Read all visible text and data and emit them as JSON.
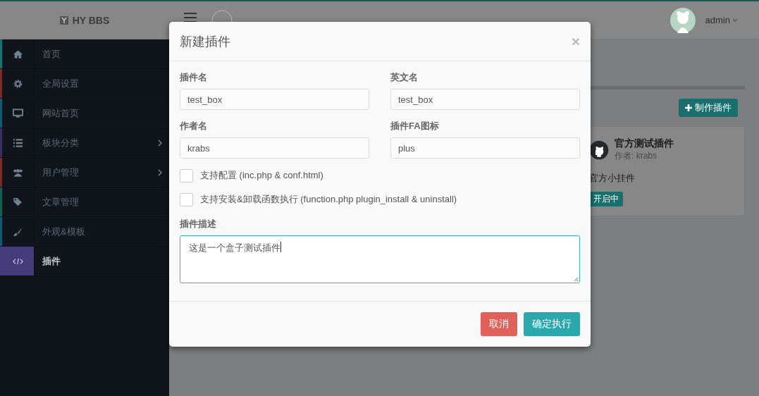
{
  "header": {
    "logo": "HY BBS",
    "user": "admin"
  },
  "sidebar": {
    "items": [
      {
        "label": "首页",
        "selected": false,
        "has_submenu": false,
        "color": "#147370"
      },
      {
        "label": "全局设置",
        "selected": false,
        "has_submenu": false,
        "color": "#7a2a27"
      },
      {
        "label": "网站首页",
        "selected": false,
        "has_submenu": false,
        "color": "#125a6e"
      },
      {
        "label": "板块分类",
        "selected": false,
        "has_submenu": true,
        "color": "#3a2f63"
      },
      {
        "label": "用户管理",
        "selected": false,
        "has_submenu": true,
        "color": "#7a2a27"
      },
      {
        "label": "文章管理",
        "selected": false,
        "has_submenu": false,
        "color": "#115e52"
      },
      {
        "label": "外观&模板",
        "selected": false,
        "has_submenu": false,
        "color": "#125a6e"
      },
      {
        "label": "插件",
        "selected": true,
        "has_submenu": false,
        "color": "#453b7a"
      }
    ]
  },
  "content": {
    "make_button": "制作插件",
    "plugin_card": {
      "title": "官方测试插件",
      "author": "作者: krabs",
      "description": "官方小挂件",
      "status": "开启中"
    }
  },
  "modal": {
    "title": "新建插件",
    "close": "×",
    "fields": [
      {
        "label": "插件名",
        "value": "test_box"
      },
      {
        "label": "英文名",
        "value": "test_box"
      },
      {
        "label": "作者名",
        "value": "krabs"
      },
      {
        "label": "插件FA图标",
        "value": "plus"
      }
    ],
    "checkboxes": [
      {
        "label": "支持配置 (inc.php & conf.html)",
        "checked": false
      },
      {
        "label": "支持安装&卸载函数执行 (function.php plugin_install & uninstall)",
        "checked": false
      }
    ],
    "description": {
      "label": "插件描述",
      "value": "这是一个盒子测试插件",
      "focused": true
    },
    "buttons": [
      {
        "label": "取消",
        "kind": "cancel"
      },
      {
        "label": "确定执行",
        "kind": "confirm"
      }
    ]
  }
}
